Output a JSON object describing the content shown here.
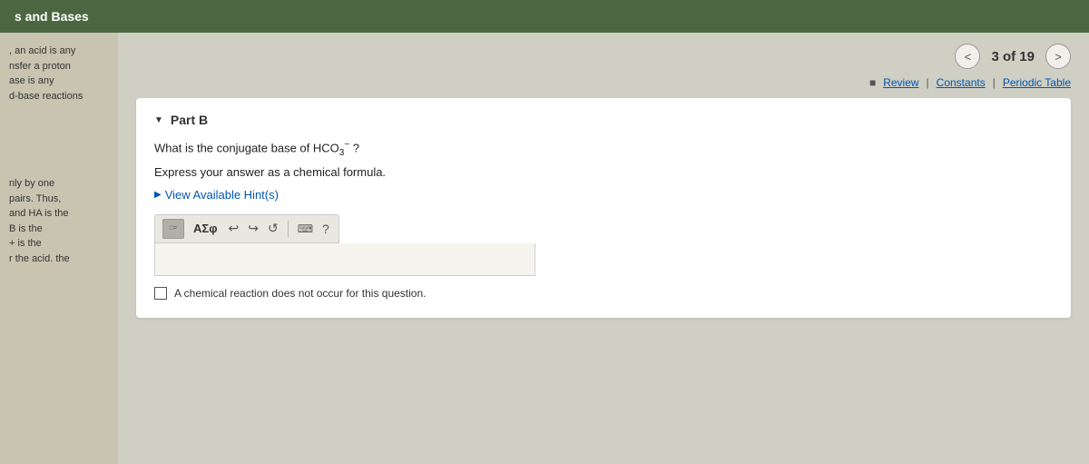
{
  "header": {
    "title": "s and Bases"
  },
  "navigation": {
    "prev_label": "<",
    "next_label": ">",
    "counter": "3 of 19"
  },
  "resources": {
    "icon_label": "■",
    "review_label": "Review",
    "separator1": "|",
    "constants_label": "Constants",
    "separator2": "|",
    "periodic_label": "Periodic Table"
  },
  "sidebar": {
    "text_line1": ", an acid is any",
    "text_line2": "nsfer a proton",
    "text_line3": "ase is any",
    "text_line4": "d-base reactions",
    "text_line5": "",
    "text_line6": "nly by one",
    "text_line7": "pairs. Thus,",
    "text_line8": "and HA is the",
    "text_line9": "B is the",
    "text_line10": "+ is the",
    "text_line11": "r the acid. the"
  },
  "part": {
    "label": "Part B",
    "question": "What is the conjugate base of HCO",
    "question_superscript": "3",
    "question_charge": "−",
    "question_suffix": " ?",
    "express_text": "Express your answer as a chemical formula.",
    "hint_label": "View Available Hint(s)",
    "toolbar": {
      "greek_label": "ΑΣφ",
      "undo_label": "↩",
      "redo_label": "↪",
      "refresh_label": "↺",
      "keyboard_label": "⌨",
      "question_label": "?"
    },
    "checkbox_label": "A chemical reaction does not occur for this question."
  }
}
